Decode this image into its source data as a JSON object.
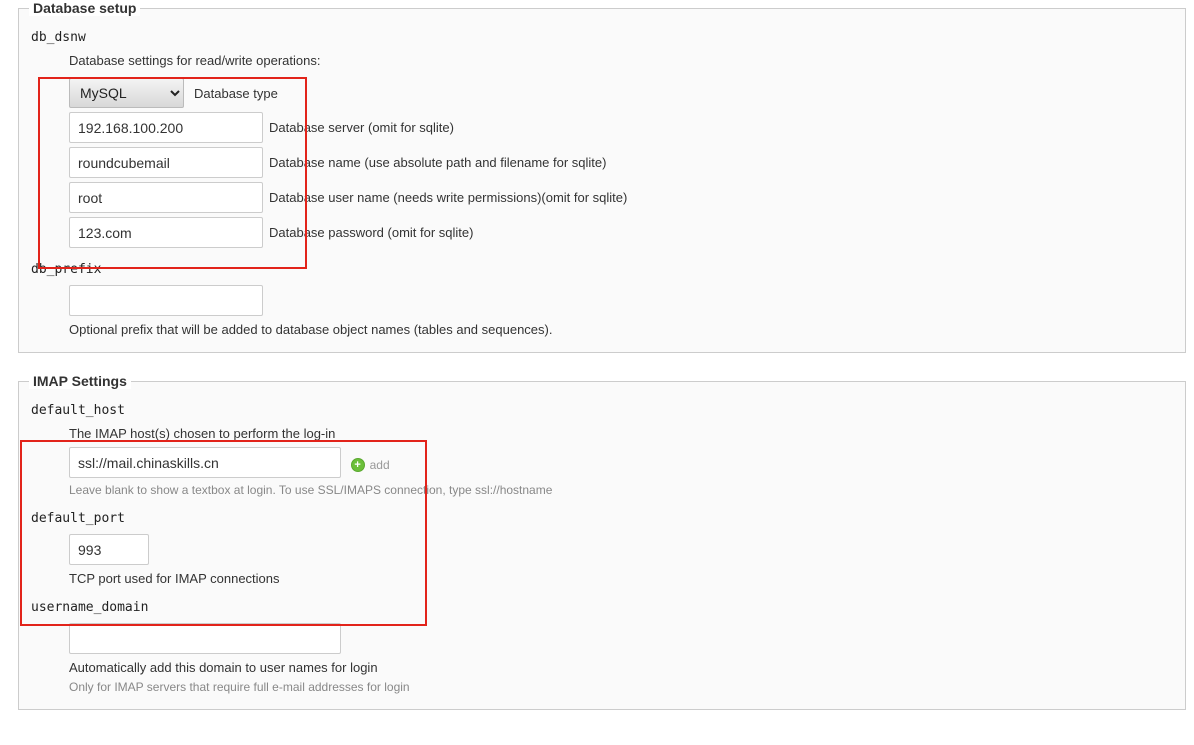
{
  "database": {
    "legend": "Database setup",
    "dsnw": {
      "name": "db_dsnw",
      "intro": "Database settings for read/write operations:",
      "type_value": "MySQL",
      "type_label": "Database type",
      "server_value": "192.168.100.200",
      "server_label": "Database server (omit for sqlite)",
      "dbname_value": "roundcubemail",
      "dbname_label": "Database name (use absolute path and filename for sqlite)",
      "user_value": "root",
      "user_label": "Database user name (needs write permissions)(omit for sqlite)",
      "pass_value": "123.com",
      "pass_label": "Database password (omit for sqlite)"
    },
    "prefix": {
      "name": "db_prefix",
      "value": "",
      "desc": "Optional prefix that will be added to database object names (tables and sequences)."
    }
  },
  "imap": {
    "legend": "IMAP Settings",
    "default_host": {
      "name": "default_host",
      "intro": "The IMAP host(s) chosen to perform the log-in",
      "value": "ssl://mail.chinaskills.cn",
      "add_label": "add",
      "hint": "Leave blank to show a textbox at login. To use SSL/IMAPS connection, type ssl://hostname"
    },
    "default_port": {
      "name": "default_port",
      "value": "993",
      "desc": "TCP port used for IMAP connections"
    },
    "username_domain": {
      "name": "username_domain",
      "value": "",
      "desc": "Automatically add this domain to user names for login",
      "hint": "Only for IMAP servers that require full e-mail addresses for login"
    }
  }
}
